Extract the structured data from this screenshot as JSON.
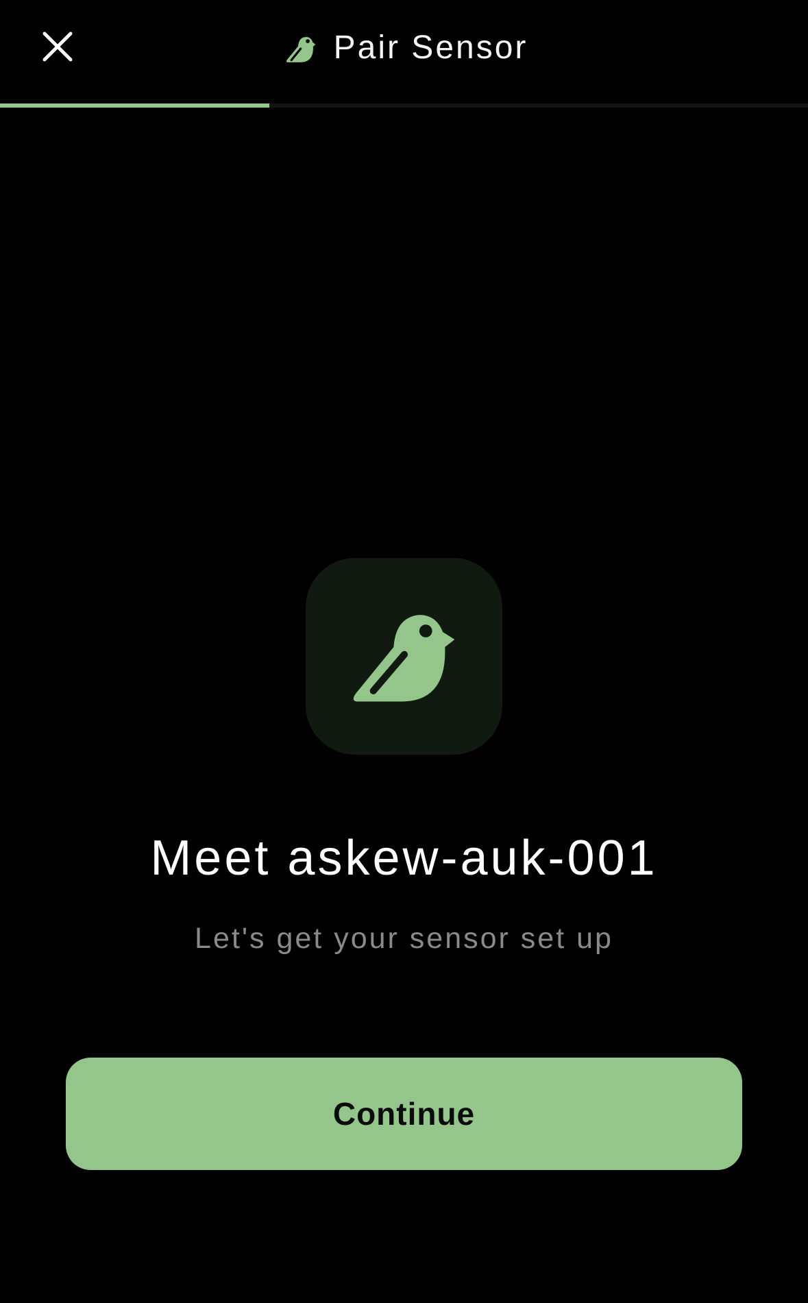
{
  "header": {
    "title": "Pair Sensor",
    "close_icon": "close-icon",
    "title_icon": "bird-icon"
  },
  "progress": {
    "fraction": 0.333
  },
  "hero": {
    "icon": "bird-icon"
  },
  "content": {
    "heading": "Meet askew-auk-001",
    "subheading": "Let's get your sensor set up"
  },
  "actions": {
    "continue_label": "Continue"
  },
  "colors": {
    "background": "#000000",
    "accent": "#94c68b",
    "tile_background": "#111a11",
    "subtext": "#8a8a8a"
  }
}
